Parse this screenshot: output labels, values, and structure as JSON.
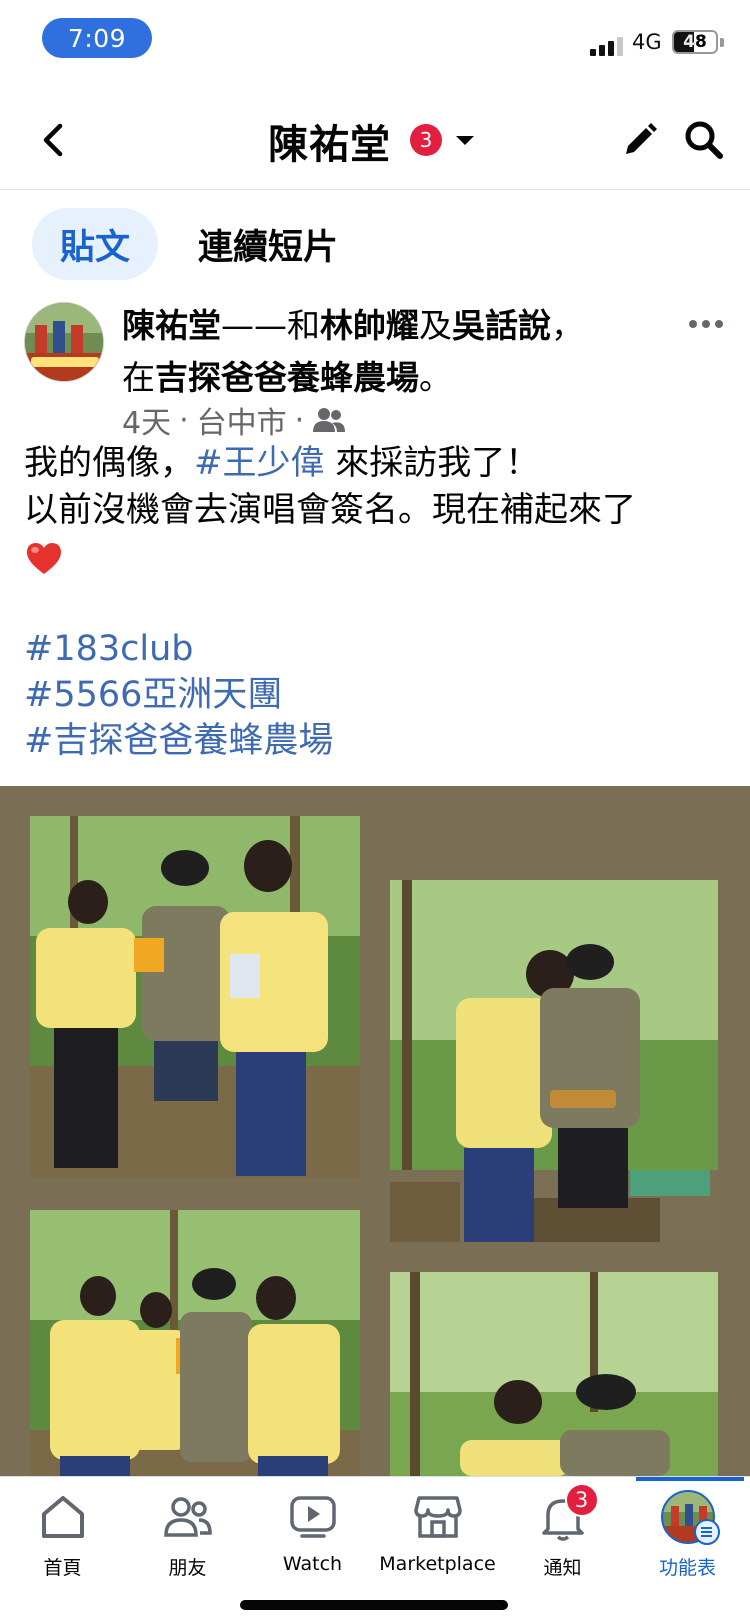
{
  "status_bar": {
    "time": "7:09",
    "network": "4G",
    "battery": "48",
    "battery_level": 0.48
  },
  "header": {
    "title": "陳祐堂",
    "badge_count": "3",
    "icons": [
      "chevron-left-icon",
      "caret-down-icon",
      "pencil-icon",
      "search-icon"
    ]
  },
  "tabs": [
    {
      "label": "貼文",
      "active": true
    },
    {
      "label": "連續短片",
      "active": false
    }
  ],
  "post": {
    "author": "陳祐堂",
    "dash": "——和",
    "tag1": "林帥耀",
    "and": "及",
    "tag2": "吳話說",
    "comma": "，",
    "at": "在",
    "place": "吉探爸爸養蜂農場",
    "period": "。",
    "time_ago": "4天",
    "location": "台中市",
    "dot": "·",
    "audience_icon": "friends-icon",
    "body_line1_prefix": "我的偶像，",
    "body_line1_link": "#王少偉",
    "body_line1_suffix": " 來採訪我了！",
    "body_line2": "以前沒機會去演唱會簽名。現在補起來了",
    "hashtags": [
      "#183club",
      "#5566亞洲天團",
      "#吉探爸爸養蜂農場"
    ]
  },
  "bottom_nav": [
    {
      "label": "首頁",
      "icon": "home-icon"
    },
    {
      "label": "朋友",
      "icon": "friends-icon"
    },
    {
      "label": "Watch",
      "icon": "video-icon"
    },
    {
      "label": "Marketplace",
      "icon": "store-icon"
    },
    {
      "label": "通知",
      "icon": "bell-icon",
      "badge": "3"
    },
    {
      "label": "功能表",
      "icon": "menu-avatar-icon",
      "active": true
    }
  ],
  "colors": {
    "accent": "#1763cf",
    "link": "#3d6ab3",
    "badge": "#e41e3f",
    "status_pill": "#2f6fde",
    "collage_bg": "#7a6f55"
  }
}
